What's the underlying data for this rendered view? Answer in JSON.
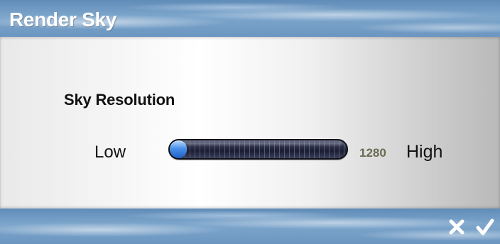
{
  "window": {
    "title": "Render Sky"
  },
  "section": {
    "heading": "Sky Resolution"
  },
  "slider": {
    "low_label": "Low",
    "high_label": "High",
    "value": "1280",
    "fill_fraction": 0.07
  },
  "footer": {
    "cancel_icon": "x-icon",
    "confirm_icon": "checkmark-icon"
  },
  "colors": {
    "title_text": "#ffffff",
    "slider_fill": "#4a90e8",
    "value_text": "#6b6b55"
  }
}
